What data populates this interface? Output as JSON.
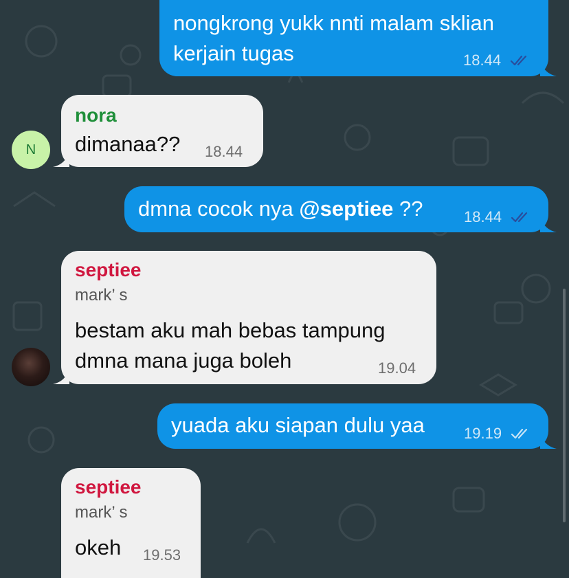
{
  "messages": [
    {
      "id": "m1",
      "direction": "outgoing",
      "lines": [
        "nongkrong yukk nnti malam sklian",
        "kerjain tugas"
      ],
      "time": "18.44",
      "status": "read"
    },
    {
      "id": "m2",
      "direction": "incoming",
      "sender": "nora",
      "avatar_initial": "N",
      "text": "dimanaa??",
      "time": "18.44"
    },
    {
      "id": "m3",
      "direction": "outgoing",
      "text_before": "dmna cocok nya ",
      "mention": "@septiee",
      "text_after": " ??",
      "time": "18.44",
      "status": "read"
    },
    {
      "id": "m4",
      "direction": "incoming",
      "sender": "septiee",
      "sender_subtitle": "mark’ s",
      "lines": [
        "bestam aku mah bebas tampung",
        "dmna mana juga boleh"
      ],
      "time": "19.04"
    },
    {
      "id": "m5",
      "direction": "outgoing",
      "text": "yuada aku siapan dulu yaa",
      "time": "19.19",
      "status": "delivered"
    },
    {
      "id": "m6",
      "direction": "incoming",
      "sender": "septiee",
      "sender_subtitle": "mark’ s",
      "text": "okeh",
      "time": "19.53"
    }
  ],
  "colors": {
    "background": "#2b3a40",
    "outgoing_bubble": "#0f93e6",
    "incoming_bubble": "#f0f0f0",
    "sender_nora": "#1f8f3a",
    "sender_septiee": "#d0173f",
    "avatar_nora_bg": "#c8f2a8"
  },
  "icons": {
    "read_status": "double-check-icon",
    "delivered_status": "double-check-icon"
  }
}
